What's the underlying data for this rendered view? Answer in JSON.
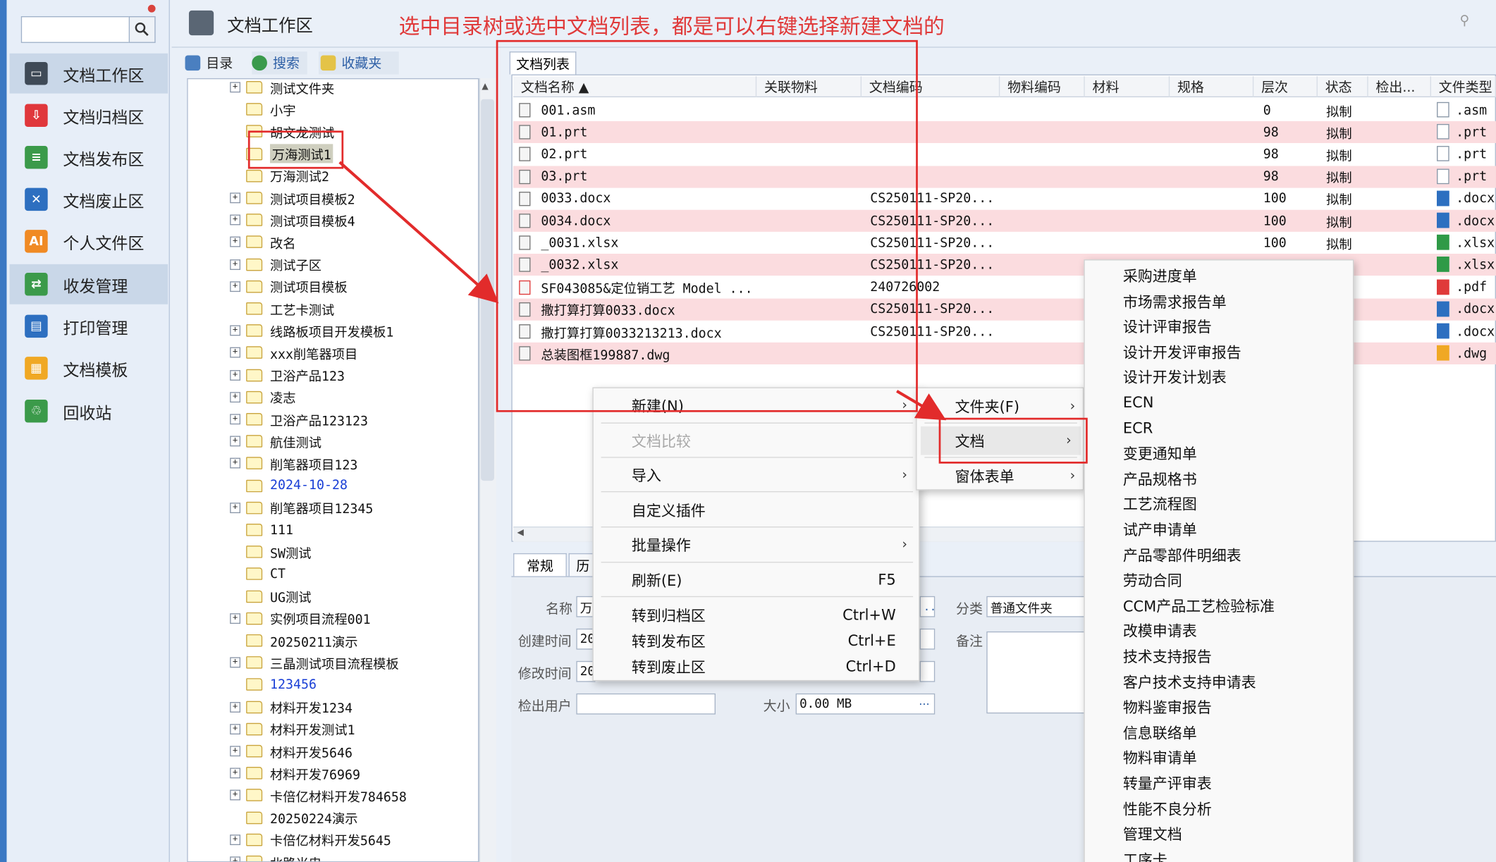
{
  "nav": {
    "items": [
      {
        "label": "文档工作区",
        "color": "#3f4a57",
        "glyph": "▭"
      },
      {
        "label": "文档归档区",
        "color": "#e0373c",
        "glyph": "⇩"
      },
      {
        "label": "文档发布区",
        "color": "#3b9a4a",
        "glyph": "≡"
      },
      {
        "label": "文档废止区",
        "color": "#2d6fc0",
        "glyph": "✕"
      },
      {
        "label": "个人文件区",
        "color": "#f08a24",
        "glyph": "AI"
      },
      {
        "label": "收发管理",
        "color": "#3b9a4a",
        "glyph": "⇄"
      },
      {
        "label": "打印管理",
        "color": "#2d6fc0",
        "glyph": "▤"
      },
      {
        "label": "文档模板",
        "color": "#f0a824",
        "glyph": "▦"
      },
      {
        "label": "回收站",
        "color": "#3b9a4a",
        "glyph": "♲"
      }
    ]
  },
  "header": {
    "title": "文档工作区",
    "annotation": "选中目录树或选中文档列表，都是可以右键选择新建文档的",
    "search_glyph": "⚲"
  },
  "tree_tabs": [
    "目录",
    "搜索",
    "收藏夹"
  ],
  "tree": [
    {
      "label": "测试文件夹",
      "exp": true
    },
    {
      "label": "小宇",
      "exp": false
    },
    {
      "label": "胡文龙测试",
      "exp": false
    },
    {
      "label": "万海测试1",
      "exp": false,
      "sel": true
    },
    {
      "label": "万海测试2",
      "exp": false
    },
    {
      "label": "测试项目模板2",
      "exp": true
    },
    {
      "label": "测试项目模板4",
      "exp": true
    },
    {
      "label": "改名",
      "exp": true
    },
    {
      "label": "测试子区",
      "exp": true
    },
    {
      "label": "测试项目模板",
      "exp": true
    },
    {
      "label": "工艺卡测试",
      "exp": false
    },
    {
      "label": "线路板项目开发模板1",
      "exp": true
    },
    {
      "label": "xxx削笔器项目",
      "exp": true
    },
    {
      "label": "卫浴产品123",
      "exp": true
    },
    {
      "label": "凌志",
      "exp": true
    },
    {
      "label": "卫浴产品123123",
      "exp": true
    },
    {
      "label": "航佳测试",
      "exp": true
    },
    {
      "label": "削笔器项目123",
      "exp": true
    },
    {
      "label": "2024-10-28",
      "exp": false,
      "blue": true
    },
    {
      "label": "削笔器项目12345",
      "exp": true
    },
    {
      "label": "111",
      "exp": false
    },
    {
      "label": "SW测试",
      "exp": false
    },
    {
      "label": "CT",
      "exp": false
    },
    {
      "label": "UG测试",
      "exp": false
    },
    {
      "label": "实例项目流程001",
      "exp": true
    },
    {
      "label": "20250211演示",
      "exp": false
    },
    {
      "label": "三晶测试项目流程模板",
      "exp": true
    },
    {
      "label": "123456",
      "exp": false,
      "blue": true
    },
    {
      "label": "材料开发1234",
      "exp": true
    },
    {
      "label": "材料开发测试1",
      "exp": true
    },
    {
      "label": "材料开发5646",
      "exp": true
    },
    {
      "label": "材料开发76969",
      "exp": true
    },
    {
      "label": "卡倍亿材料开发784658",
      "exp": true
    },
    {
      "label": "20250224演示",
      "exp": false
    },
    {
      "label": "卡倍亿材料开发5645",
      "exp": true
    },
    {
      "label": "北路米忠",
      "exp": true
    }
  ],
  "doclist": {
    "tab": "文档列表",
    "columns": [
      "文档名称 ▲",
      "关联物料",
      "文档编码",
      "物料编码",
      "材料",
      "规格",
      "层次",
      "状态",
      "检出...",
      "文件类型"
    ],
    "rows": [
      {
        "name": "001.asm",
        "code": "",
        "level": "0",
        "status": "拟制",
        "ftype": ".asm",
        "fcolor": "#fff",
        "pink": false
      },
      {
        "name": "01.prt",
        "code": "",
        "level": "98",
        "status": "拟制",
        "ftype": ".prt",
        "fcolor": "#fff",
        "pink": true
      },
      {
        "name": "02.prt",
        "code": "",
        "level": "98",
        "status": "拟制",
        "ftype": ".prt",
        "fcolor": "#fff",
        "pink": false
      },
      {
        "name": "03.prt",
        "code": "",
        "level": "98",
        "status": "拟制",
        "ftype": ".prt",
        "fcolor": "#fff",
        "pink": true
      },
      {
        "name": "0033.docx",
        "code": "CS250111-SP20...",
        "level": "100",
        "status": "拟制",
        "ftype": ".docx",
        "fcolor": "#2d6fc0",
        "pink": false
      },
      {
        "name": "0034.docx",
        "code": "CS250111-SP20...",
        "level": "100",
        "status": "拟制",
        "ftype": ".docx",
        "fcolor": "#2d6fc0",
        "pink": true
      },
      {
        "name": "_0031.xlsx",
        "code": "CS250111-SP20...",
        "level": "100",
        "status": "拟制",
        "ftype": ".xlsx",
        "fcolor": "#2f9a47",
        "pink": false
      },
      {
        "name": "_0032.xlsx",
        "code": "CS250111-SP20...",
        "level": "",
        "status": "",
        "ftype": ".xlsx",
        "fcolor": "#2f9a47",
        "pink": true
      },
      {
        "name": "SF043085&定位销工艺 Model ...",
        "code": "240726002",
        "level": "",
        "status": "",
        "ftype": ".pdf",
        "fcolor": "#e03a3a",
        "pink": false
      },
      {
        "name": "撒打算打算0033.docx",
        "code": "CS250111-SP20...",
        "level": "",
        "status": "",
        "ftype": ".docx",
        "fcolor": "#2d6fc0",
        "pink": true
      },
      {
        "name": "撒打算打算0033213213.docx",
        "code": "CS250111-SP20...",
        "level": "",
        "status": "",
        "ftype": ".docx",
        "fcolor": "#2d6fc0",
        "pink": false
      },
      {
        "name": "总装图框199887.dwg",
        "code": "",
        "level": "",
        "status": "",
        "ftype": ".dwg",
        "fcolor": "#f0a824",
        "pink": true
      }
    ]
  },
  "props": {
    "tabs": [
      "常规",
      "历"
    ],
    "name_label": "名称",
    "name_value": "万",
    "created_label": "创建时间",
    "created_value": "20",
    "modified_label": "修改时间",
    "modified_value": "20",
    "checkout_label": "检出用户",
    "checkout_value": "",
    "category_label": "分类",
    "category_value": "普通文件夹",
    "note_label": "备注",
    "size_label": "大小",
    "size_value": "0.00 MB",
    "ellipsis": "..."
  },
  "context_menu": {
    "items": [
      {
        "label": "新建(N)",
        "shortcut": "",
        "arrow": true
      },
      {
        "label": "文档比较",
        "shortcut": "",
        "disabled": true
      },
      {
        "label": "导入",
        "shortcut": "",
        "arrow": true
      },
      {
        "label": "自定义插件",
        "shortcut": ""
      },
      {
        "label": "批量操作",
        "shortcut": "",
        "arrow": true
      },
      {
        "label": "刷新(E)",
        "shortcut": "F5"
      },
      {
        "label": "转到归档区",
        "shortcut": "Ctrl+W"
      },
      {
        "label": "转到发布区",
        "shortcut": "Ctrl+E"
      },
      {
        "label": "转到废止区",
        "shortcut": "Ctrl+D"
      }
    ]
  },
  "new_submenu": {
    "items": [
      "文件夹(F)",
      "文档",
      "窗体表单"
    ]
  },
  "doc_submenu": {
    "items": [
      "采购进度单",
      "市场需求报告单",
      "设计评审报告",
      "设计开发评审报告",
      "设计开发计划表",
      "ECN",
      "ECR",
      "变更通知单",
      "产品规格书",
      "工艺流程图",
      "试产申请单",
      "产品零部件明细表",
      "劳动合同",
      "CCM产品工艺检验标准",
      "改模申请表",
      "技术支持报告",
      "客户技术支持申请表",
      "物料鉴审报告",
      "信息联络单",
      "物料审请单",
      "转量产评审表",
      "性能不良分析",
      "管理文档",
      "工序卡"
    ]
  },
  "arrow_glyph": "›",
  "accent": "#e22b2b"
}
